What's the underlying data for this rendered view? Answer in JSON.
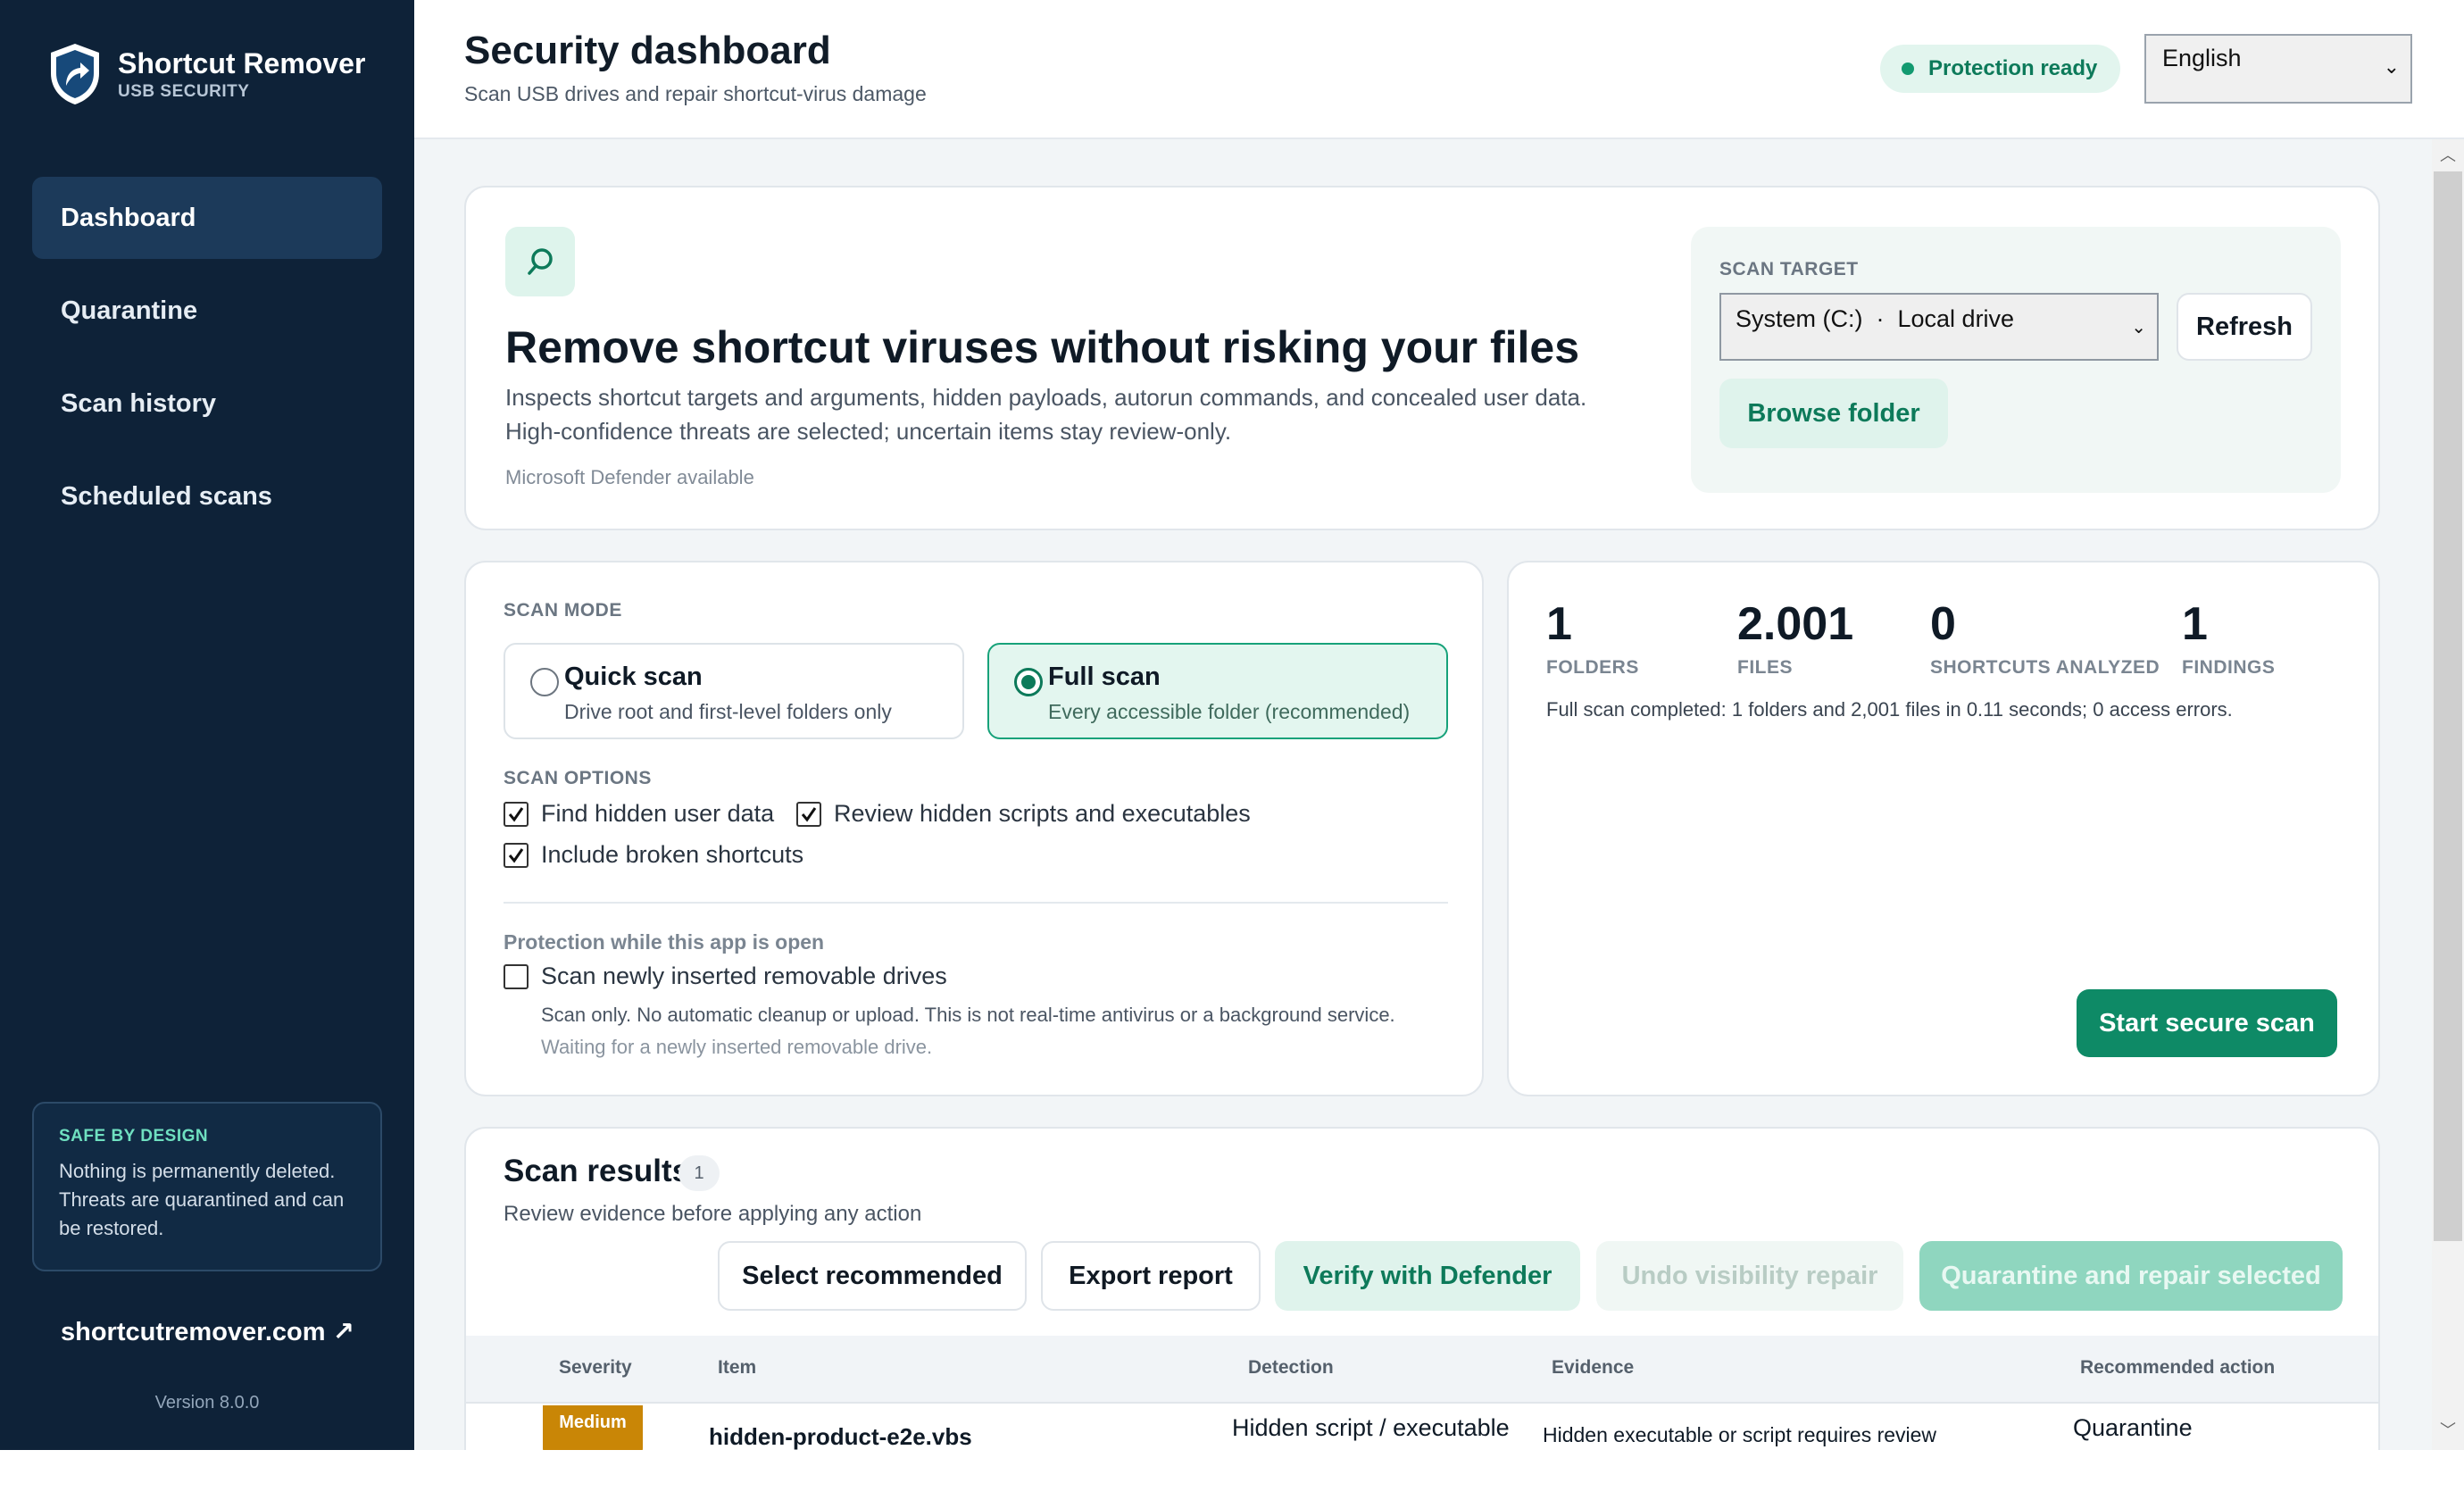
{
  "app": {
    "title": "Shortcut Remover",
    "subtitle": "USB SECURITY"
  },
  "sidebar": {
    "items": [
      {
        "label": "Dashboard",
        "active": true
      },
      {
        "label": "Quarantine",
        "active": false
      },
      {
        "label": "Scan history",
        "active": false
      },
      {
        "label": "Scheduled scans",
        "active": false
      }
    ],
    "safe_box": {
      "title": "SAFE BY DESIGN",
      "text": "Nothing is permanently deleted. Threats are quarantined and can be restored."
    },
    "site_link": "shortcutremover.com ↗",
    "version": "Version 8.0.0"
  },
  "header": {
    "title": "Security dashboard",
    "subtitle": "Scan USB drives and repair shortcut-virus damage",
    "status": "Protection ready",
    "language": "English"
  },
  "hero": {
    "icon": "search-icon",
    "title": "Remove shortcut viruses without risking your files",
    "desc_line1": "Inspects shortcut targets and arguments, hidden payloads, autorun commands, and concealed user data.",
    "desc_line2": "High-confidence threats are selected; uncertain items stay review-only.",
    "note": "Microsoft Defender available",
    "scan_target_label": "SCAN TARGET",
    "scan_target_value": "System (C:)  ·  Local drive",
    "refresh_label": "Refresh",
    "browse_label": "Browse folder"
  },
  "scan_mode": {
    "label": "SCAN MODE",
    "options": [
      {
        "title": "Quick scan",
        "desc": "Drive root and first-level folders only",
        "selected": false
      },
      {
        "title": "Full scan",
        "desc": "Every accessible folder (recommended)",
        "selected": true
      }
    ],
    "options_label": "SCAN OPTIONS",
    "checks": [
      {
        "label": "Find hidden user data",
        "checked": true
      },
      {
        "label": "Review hidden scripts and executables",
        "checked": true
      },
      {
        "label": "Include broken shortcuts",
        "checked": true
      }
    ],
    "protection_title": "Protection while this app is open",
    "protection_check": {
      "label": "Scan newly inserted removable drives",
      "checked": false
    },
    "protection_note": "Scan only. No automatic cleanup or upload. This is not real-time antivirus or a background service.",
    "protection_wait": "Waiting for a newly inserted removable drive."
  },
  "stats": {
    "items": [
      {
        "value": "1",
        "label": "FOLDERS"
      },
      {
        "value": "2.001",
        "label": "FILES"
      },
      {
        "value": "0",
        "label": "SHORTCUTS ANALYZED"
      },
      {
        "value": "1",
        "label": "FINDINGS"
      }
    ],
    "summary": "Full scan completed: 1 folders and 2,001 files in 0.11 seconds; 0 access errors.",
    "start_label": "Start secure scan"
  },
  "results": {
    "title": "Scan results",
    "count": "1",
    "subtitle": "Review evidence before applying any action",
    "buttons": {
      "select": "Select recommended",
      "export": "Export report",
      "verify": "Verify with Defender",
      "undo": "Undo visibility repair",
      "quarantine": "Quarantine and repair selected"
    },
    "columns": [
      "Severity",
      "Item",
      "Detection",
      "Evidence",
      "Recommended action"
    ],
    "rows": [
      {
        "severity": "Medium",
        "item": "hidden-product-e2e.vbs",
        "detection": "Hidden script / executable",
        "evidence": "Hidden executable or script requires review",
        "action": "Quarantine"
      }
    ]
  },
  "colors": {
    "sidebar_bg": "#0e2238",
    "accent": "#0e8a66",
    "severity_medium": "#c98606"
  }
}
